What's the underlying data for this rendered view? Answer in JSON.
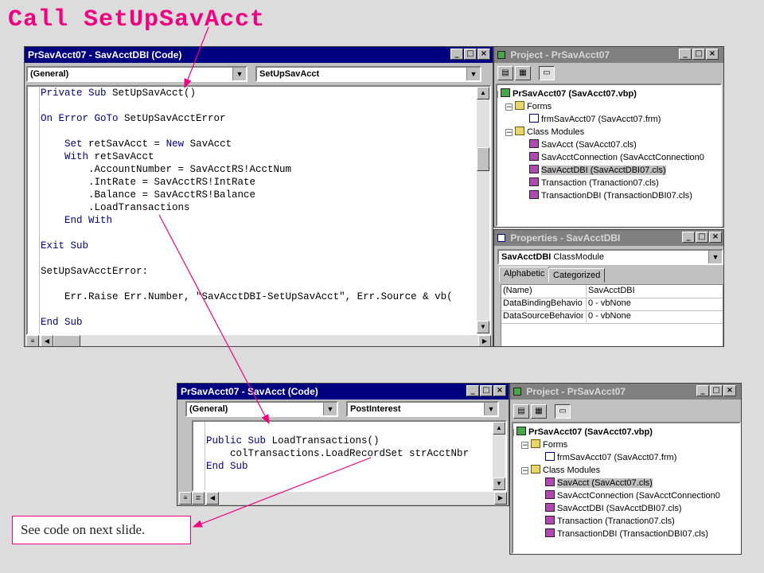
{
  "slide_title": "Call SetUpSavAcct",
  "note_text": "See code on next slide.",
  "top_code_window": {
    "title": "PrSavAcct07 - SavAcctDBI (Code)",
    "object_combo": "(General)",
    "proc_combo": "SetUpSavAcct"
  },
  "top_code": [
    {
      "pre": "",
      "kw": "Private Sub",
      "rest": " SetUpSavAcct()"
    },
    {
      "pre": "",
      "kw": "",
      "rest": ""
    },
    {
      "pre": "",
      "kw": "On Error GoTo",
      "rest": " SetUpSavAcctError"
    },
    {
      "pre": "",
      "kw": "",
      "rest": ""
    },
    {
      "pre": "    ",
      "kw": "Set",
      "rest": " retSavAcct = ",
      "kw2": "New",
      "rest2": " SavAcct"
    },
    {
      "pre": "    ",
      "kw": "With",
      "rest": " retSavAcct"
    },
    {
      "pre": "        ",
      "kw": "",
      "rest": ".AccountNumber = SavAcctRS!AcctNum"
    },
    {
      "pre": "        ",
      "kw": "",
      "rest": ".IntRate = SavAcctRS!IntRate"
    },
    {
      "pre": "        ",
      "kw": "",
      "rest": ".Balance = SavAcctRS!Balance"
    },
    {
      "pre": "        ",
      "kw": "",
      "rest": ".LoadTransactions"
    },
    {
      "pre": "    ",
      "kw": "End With",
      "rest": ""
    },
    {
      "pre": "",
      "kw": "",
      "rest": ""
    },
    {
      "pre": "",
      "kw": "Exit Sub",
      "rest": ""
    },
    {
      "pre": "",
      "kw": "",
      "rest": ""
    },
    {
      "pre": "",
      "kw": "",
      "rest": "SetUpSavAcctError:"
    },
    {
      "pre": "",
      "kw": "",
      "rest": ""
    },
    {
      "pre": "    ",
      "kw": "",
      "rest": "Err.Raise Err.Number, \"SavAcctDBI-SetUpSavAcct\", Err.Source & vb("
    },
    {
      "pre": "",
      "kw": "",
      "rest": ""
    },
    {
      "pre": "",
      "kw": "End Sub",
      "rest": ""
    }
  ],
  "top_project": {
    "title": "Project - PrSavAcct07",
    "root": "PrSavAcct07 (SavAcct07.vbp)",
    "forms_folder": "Forms",
    "form": "frmSavAcct07 (SavAcct07.frm)",
    "class_folder": "Class Modules",
    "classes": [
      "SavAcct (SavAcct07.cls)",
      "SavAcctConnection (SavAcctConnection0",
      "SavAcctDBI (SavAcctDBI07.cls)",
      "Transaction (Tranaction07.cls)",
      "TransactionDBI (TransactionDBI07.cls)"
    ],
    "selected_index": 2
  },
  "properties": {
    "title": "Properties - SavAcctDBI",
    "object_combo_bold": "SavAcctDBI",
    "object_combo_rest": "ClassModule",
    "tab_alphabetic": "Alphabetic",
    "tab_categorized": "Categorized",
    "rows": [
      {
        "name": "(Name)",
        "value": "SavAcctDBI"
      },
      {
        "name": "DataBindingBehavior",
        "value": "0 - vbNone"
      },
      {
        "name": "DataSourceBehavior",
        "value": "0 - vbNone"
      }
    ]
  },
  "bottom_code_window": {
    "title": "PrSavAcct07 - SavAcct (Code)",
    "object_combo": "(General)",
    "proc_combo": "PostInterest"
  },
  "bottom_code": [
    {
      "pre": "",
      "kw": "Public Sub",
      "rest": " LoadTransactions()"
    },
    {
      "pre": "    ",
      "kw": "",
      "rest": "colTransactions.LoadRecordSet strAcctNbr"
    },
    {
      "pre": "",
      "kw": "End Sub",
      "rest": ""
    }
  ],
  "bottom_project": {
    "title": "Project - PrSavAcct07",
    "root": "PrSavAcct07 (SavAcct07.vbp)",
    "forms_folder": "Forms",
    "form": "frmSavAcct07 (SavAcct07.frm)",
    "class_folder": "Class Modules",
    "classes": [
      "SavAcct (SavAcct07.cls)",
      "SavAcctConnection (SavAcctConnection0",
      "SavAcctDBI (SavAcctDBI07.cls)",
      "Transaction (Tranaction07.cls)",
      "TransactionDBI (TransactionDBI07.cls)"
    ],
    "selected_index": 0
  },
  "colors": {
    "accent": "#f2007f",
    "title_bar": "#000080",
    "keyword": "#000080"
  }
}
